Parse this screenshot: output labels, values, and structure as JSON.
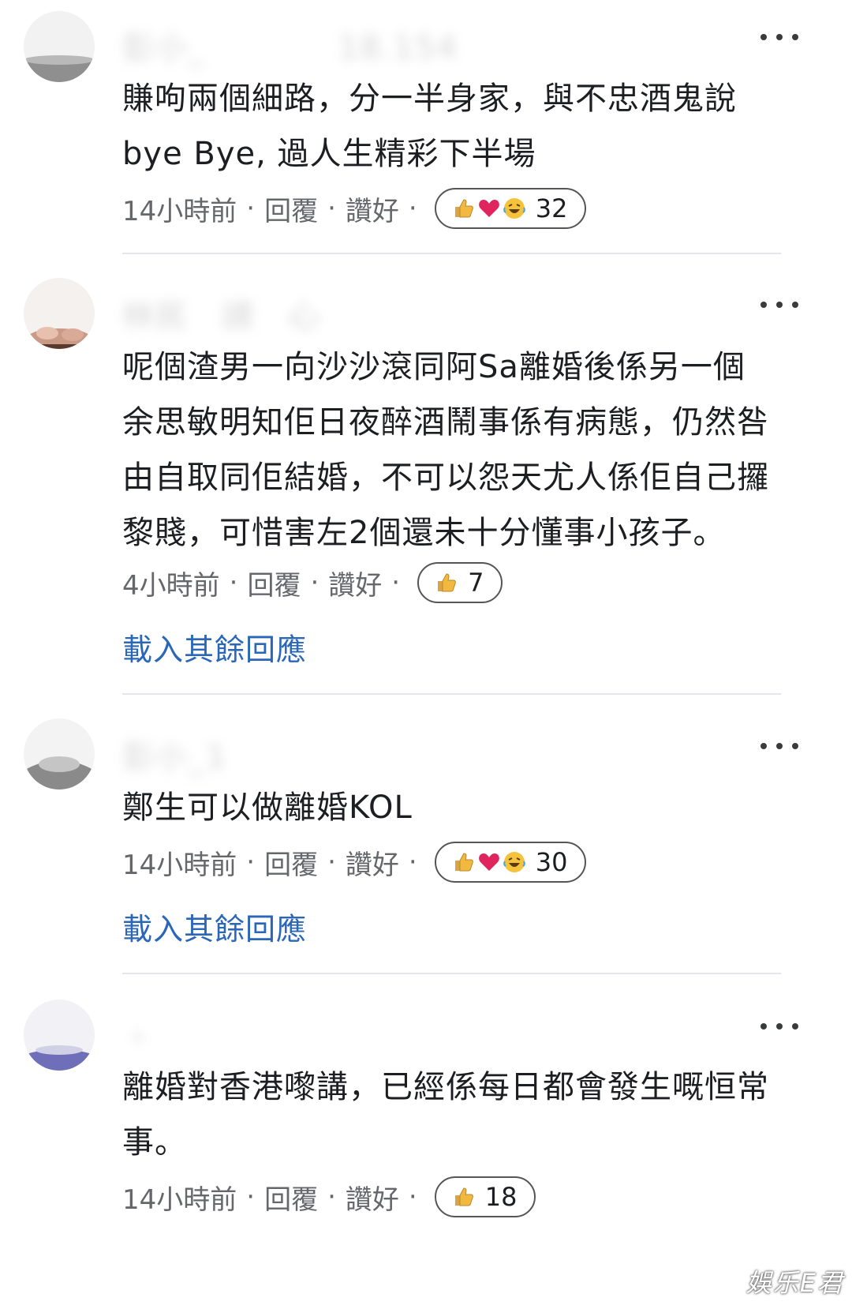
{
  "comments": [
    {
      "username": "彭小_　　　　18.154",
      "lines": [
        "賺呴兩個細路，分一半身家，與不忠酒鬼說",
        "bye Bye, 過人生精彩下半場"
      ],
      "time": "14小時前",
      "reply": "回覆",
      "like": "讚好",
      "reactions": [
        "like",
        "love",
        "haha"
      ],
      "reaction_count": "32",
      "load_more": ""
    },
    {
      "username": "林民　請　心",
      "lines": [
        "呢個渣男一向沙沙滾同阿Sa離婚後係另一個",
        "余思敏明知佢日夜醉酒鬧事係有病態，仍然咎",
        "由自取同佢結婚，不可以怨天尤人係佢自己攞",
        "黎賤，可惜害左2個還未十分懂事小孩子。"
      ],
      "time": "4小時前",
      "reply": "回覆",
      "like": "讚好",
      "reactions": [
        "like"
      ],
      "reaction_count": "7",
      "load_more": "載入其餘回應"
    },
    {
      "username": "彭小_1　　　",
      "lines": [
        "鄭生可以做離婚KOL"
      ],
      "time": "14小時前",
      "reply": "回覆",
      "like": "讚好",
      "reactions": [
        "like",
        "love",
        "haha"
      ],
      "reaction_count": "30",
      "load_more": "載入其餘回應"
    },
    {
      "username": "・　",
      "lines": [
        "離婚對香港嚟講，已經係每日都會發生嘅恒常",
        "事。"
      ],
      "time": "14小時前",
      "reply": "回覆",
      "like": "讚好",
      "reactions": [
        "like"
      ],
      "reaction_count": "18",
      "load_more": ""
    }
  ],
  "watermark": "娛乐E君",
  "colors": {
    "text": "#1c1e21",
    "meta": "#65676b",
    "link": "#2a67b8",
    "divider": "#e4e6eb"
  }
}
